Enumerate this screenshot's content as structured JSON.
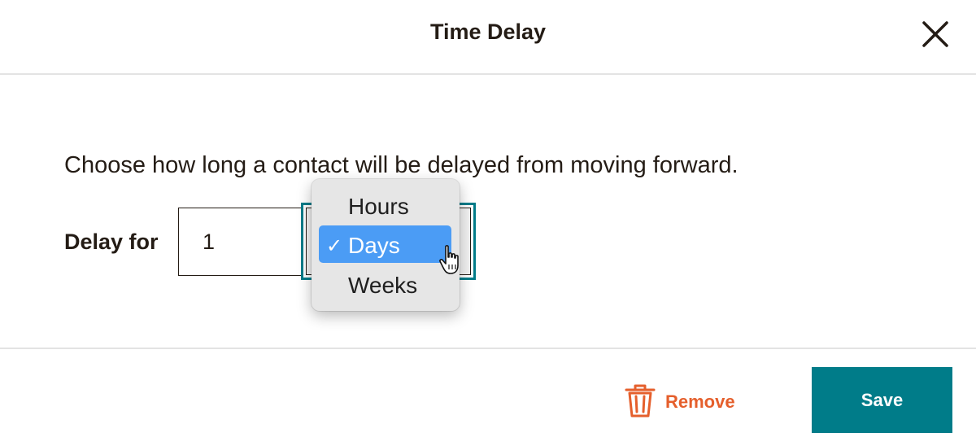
{
  "dialog": {
    "title": "Time Delay",
    "close_icon": "close-icon"
  },
  "body": {
    "description": "Choose how long a contact will be delayed from moving forward.",
    "delay_label": "Delay for",
    "delay_value": "1",
    "unit_options": [
      {
        "label": "Hours",
        "selected": false
      },
      {
        "label": "Days",
        "selected": true
      },
      {
        "label": "Weeks",
        "selected": false
      }
    ],
    "selected_unit": "Days",
    "check_mark": "✓"
  },
  "footer": {
    "remove_label": "Remove",
    "remove_icon": "trash-icon",
    "save_label": "Save"
  },
  "colors": {
    "accent": "#007c89",
    "remove": "#e55f2c",
    "selection": "#4b9cf5",
    "text": "#241c15"
  }
}
